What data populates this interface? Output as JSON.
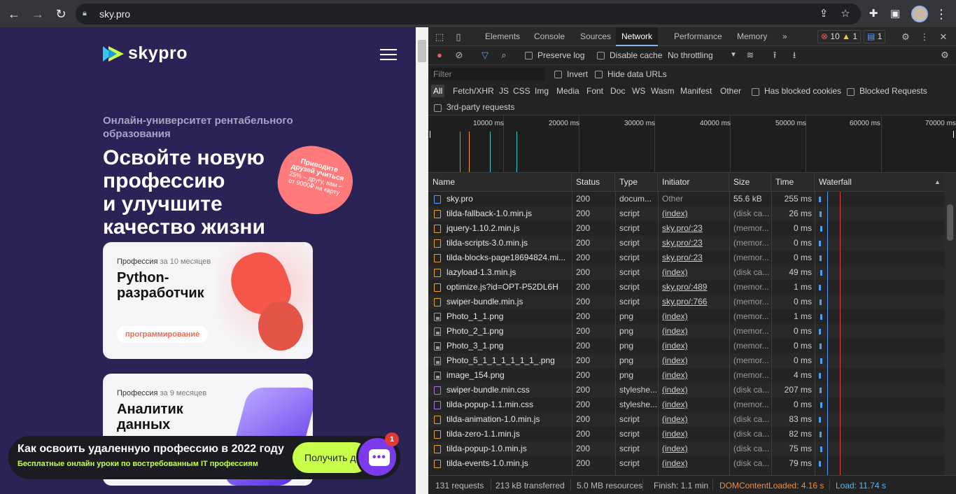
{
  "browser": {
    "url": "sky.pro",
    "icons": {
      "back": "arrow-left-icon",
      "forward": "arrow-right-icon",
      "reload": "reload-icon",
      "lock": "lock-icon",
      "share": "share-icon",
      "star": "star-icon",
      "extensions": "puzzle-icon",
      "sidepanel": "side-panel-icon",
      "menu": "kebab-icon"
    }
  },
  "site": {
    "logo_text": "skypro",
    "subtitle": "Онлайн-университет рентабельного образования",
    "headline_lines": [
      "Освойте новую",
      "профессию",
      "и улучшите",
      "качество жизни"
    ],
    "badge": {
      "line1": "Приводите",
      "line2": "друзей учиться",
      "line3": "25% – другу, вам –",
      "line4": "от 9000₽ на карту"
    },
    "cards": [
      {
        "meta_prefix": "Профессия",
        "meta_duration": "за 10 месяцев",
        "title_line1": "Python-",
        "title_line2": "разработчик",
        "tag": "программирование"
      },
      {
        "meta_prefix": "Профессия",
        "meta_duration": "за 9 месяцев",
        "title_line1": "Аналитик",
        "title_line2": "данных"
      }
    ],
    "banner": {
      "title": "Как освоить удаленную профессию в 2022 году",
      "subtitle": "Бесплатные онлайн уроки по востребованным IT профессиям",
      "button": "Получить доступ"
    },
    "chat_badge": "1"
  },
  "devtools": {
    "tabs": [
      "Elements",
      "Console",
      "Sources",
      "Network",
      "Performance",
      "Memory"
    ],
    "active_tab": "Network",
    "more": "»",
    "errors": "10",
    "warnings": "1",
    "messages": "1",
    "toolbar": {
      "preserve_log": "Preserve log",
      "disable_cache": "Disable cache",
      "throttling": "No throttling"
    },
    "filter": {
      "placeholder": "Filter",
      "invert": "Invert",
      "hide_data_urls": "Hide data URLs",
      "types": [
        "All",
        "Fetch/XHR",
        "JS",
        "CSS",
        "Img",
        "Media",
        "Font",
        "Doc",
        "WS",
        "Wasm",
        "Manifest",
        "Other"
      ],
      "has_blocked_cookies": "Has blocked cookies",
      "blocked_requests": "Blocked Requests",
      "third_party": "3rd-party requests"
    },
    "overview_ticks": [
      "10000 ms",
      "20000 ms",
      "30000 ms",
      "40000 ms",
      "50000 ms",
      "60000 ms",
      "70000 ms"
    ],
    "columns": {
      "name": "Name",
      "status": "Status",
      "type": "Type",
      "initiator": "Initiator",
      "size": "Size",
      "time": "Time",
      "waterfall": "Waterfall"
    },
    "rows": [
      {
        "name": "sky.pro",
        "status": "200",
        "type": "docum...",
        "initiator": "Other",
        "size": "55.6 kB",
        "time": "255 ms",
        "icon": "doc"
      },
      {
        "name": "tilda-fallback-1.0.min.js",
        "status": "200",
        "type": "script",
        "initiator": "(index)",
        "size": "(disk ca...",
        "time": "26 ms",
        "icon": "js"
      },
      {
        "name": "jquery-1.10.2.min.js",
        "status": "200",
        "type": "script",
        "initiator": "sky.pro/:23",
        "size": "(memor...",
        "time": "0 ms",
        "icon": "js"
      },
      {
        "name": "tilda-scripts-3.0.min.js",
        "status": "200",
        "type": "script",
        "initiator": "sky.pro/:23",
        "size": "(memor...",
        "time": "0 ms",
        "icon": "js"
      },
      {
        "name": "tilda-blocks-page18694824.mi...",
        "status": "200",
        "type": "script",
        "initiator": "sky.pro/:23",
        "size": "(memor...",
        "time": "0 ms",
        "icon": "js"
      },
      {
        "name": "lazyload-1.3.min.js",
        "status": "200",
        "type": "script",
        "initiator": "(index)",
        "size": "(disk ca...",
        "time": "49 ms",
        "icon": "js"
      },
      {
        "name": "optimize.js?id=OPT-P52DL6H",
        "status": "200",
        "type": "script",
        "initiator": "sky.pro/:489",
        "size": "(memor...",
        "time": "1 ms",
        "icon": "js"
      },
      {
        "name": "swiper-bundle.min.js",
        "status": "200",
        "type": "script",
        "initiator": "sky.pro/:766",
        "size": "(memor...",
        "time": "0 ms",
        "icon": "js"
      },
      {
        "name": "Photo_1_1.png",
        "status": "200",
        "type": "png",
        "initiator": "(index)",
        "size": "(memor...",
        "time": "1 ms",
        "icon": "img"
      },
      {
        "name": "Photo_2_1.png",
        "status": "200",
        "type": "png",
        "initiator": "(index)",
        "size": "(memor...",
        "time": "0 ms",
        "icon": "img"
      },
      {
        "name": "Photo_3_1.png",
        "status": "200",
        "type": "png",
        "initiator": "(index)",
        "size": "(memor...",
        "time": "0 ms",
        "icon": "img"
      },
      {
        "name": "Photo_5_1_1_1_1_1_1_.png",
        "status": "200",
        "type": "png",
        "initiator": "(index)",
        "size": "(memor...",
        "time": "0 ms",
        "icon": "img"
      },
      {
        "name": "image_154.png",
        "status": "200",
        "type": "png",
        "initiator": "(index)",
        "size": "(memor...",
        "time": "4 ms",
        "icon": "img"
      },
      {
        "name": "swiper-bundle.min.css",
        "status": "200",
        "type": "styleshe...",
        "initiator": "(index)",
        "size": "(disk ca...",
        "time": "207 ms",
        "icon": "css"
      },
      {
        "name": "tilda-popup-1.1.min.css",
        "status": "200",
        "type": "styleshe...",
        "initiator": "(index)",
        "size": "(memor...",
        "time": "0 ms",
        "icon": "css"
      },
      {
        "name": "tilda-animation-1.0.min.js",
        "status": "200",
        "type": "script",
        "initiator": "(index)",
        "size": "(disk ca...",
        "time": "83 ms",
        "icon": "js"
      },
      {
        "name": "tilda-zero-1.1.min.js",
        "status": "200",
        "type": "script",
        "initiator": "(index)",
        "size": "(disk ca...",
        "time": "82 ms",
        "icon": "js"
      },
      {
        "name": "tilda-popup-1.0.min.js",
        "status": "200",
        "type": "script",
        "initiator": "(index)",
        "size": "(disk ca...",
        "time": "75 ms",
        "icon": "js"
      },
      {
        "name": "tilda-events-1.0.min.js",
        "status": "200",
        "type": "script",
        "initiator": "(index)",
        "size": "(disk ca...",
        "time": "79 ms",
        "icon": "js"
      }
    ],
    "summary": {
      "requests": "131 requests",
      "transferred": "213 kB transferred",
      "resources": "5.0 MB resources",
      "finish": "Finish: 1.1 min",
      "dom_loaded": "DOMContentLoaded: 4.16 s",
      "load": "Load: 11.74 s"
    },
    "colors": {
      "dom_line": "#f08a4a",
      "load_line": "#e04040",
      "bar": "#4ba3f5"
    }
  }
}
